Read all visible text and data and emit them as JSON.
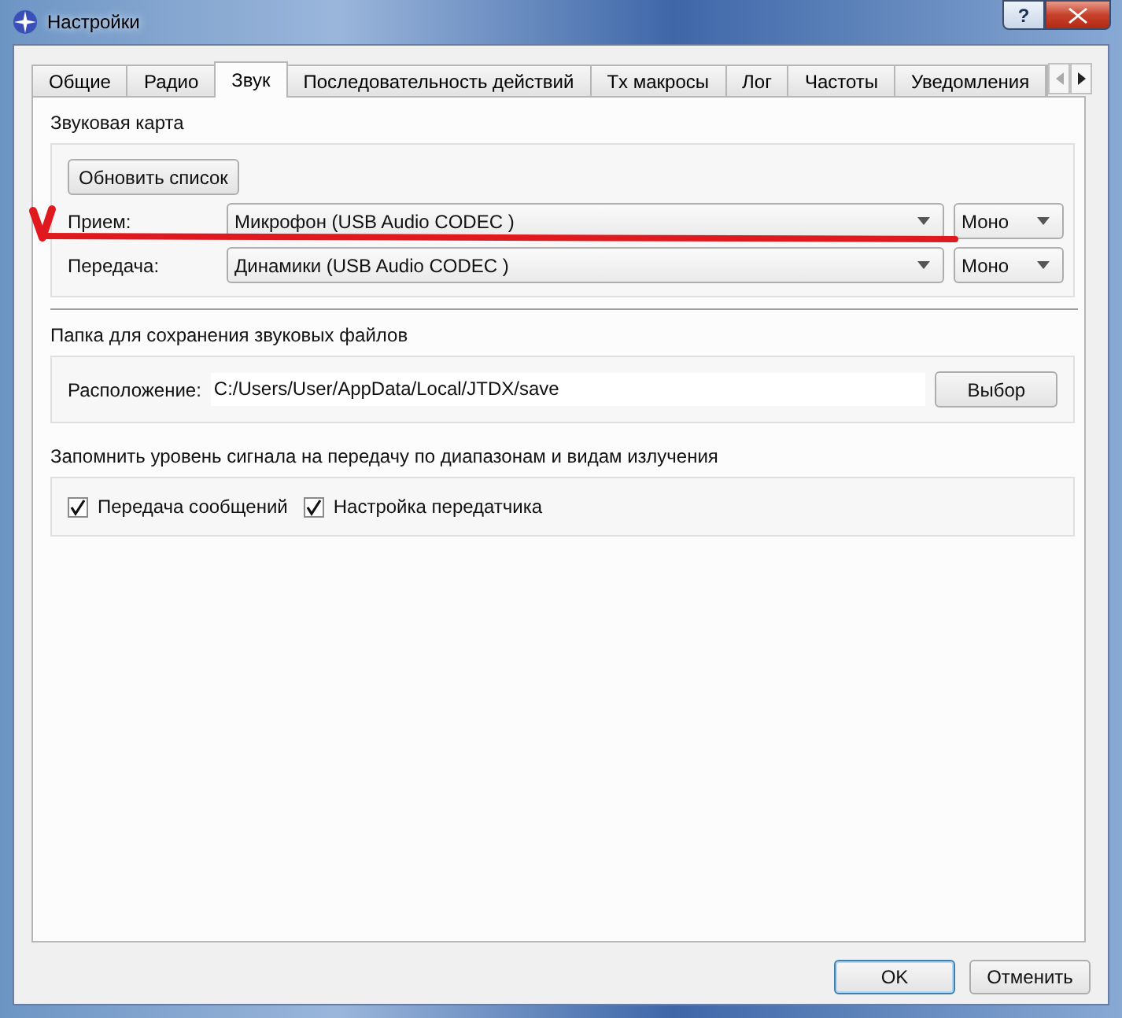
{
  "window": {
    "title": "Настройки",
    "help": "?"
  },
  "tabs": [
    {
      "label": "Общие",
      "selected": false
    },
    {
      "label": "Радио",
      "selected": false
    },
    {
      "label": "Звук",
      "selected": true
    },
    {
      "label": "Последовательность действий",
      "selected": false
    },
    {
      "label": "Tx макросы",
      "selected": false
    },
    {
      "label": "Лог",
      "selected": false
    },
    {
      "label": "Частоты",
      "selected": false
    },
    {
      "label": "Уведомления",
      "selected": false
    }
  ],
  "sound_card": {
    "title": "Звуковая карта",
    "refresh_button": "Обновить список",
    "rows": [
      {
        "label": "Прием:",
        "device": "Микрофон (USB Audio CODEC )",
        "mode": "Моно"
      },
      {
        "label": "Передача:",
        "device": "Динамики (USB Audio CODEC )",
        "mode": "Моно"
      }
    ]
  },
  "save_folder": {
    "title": "Папка для сохранения звуковых файлов",
    "label": "Расположение:",
    "path": "C:/Users/User/AppData/Local/JTDX/save",
    "button": "Выбор"
  },
  "tx_level": {
    "title": "Запомнить уровень сигнала на передачу по диапазонам и видам излучения",
    "checkboxes": [
      {
        "label": "Передача сообщений",
        "checked": true
      },
      {
        "label": "Настройка передатчика",
        "checked": true
      }
    ]
  },
  "buttons": [
    {
      "label": "OK",
      "default": true
    },
    {
      "label": "Отменить",
      "default": false
    }
  ]
}
